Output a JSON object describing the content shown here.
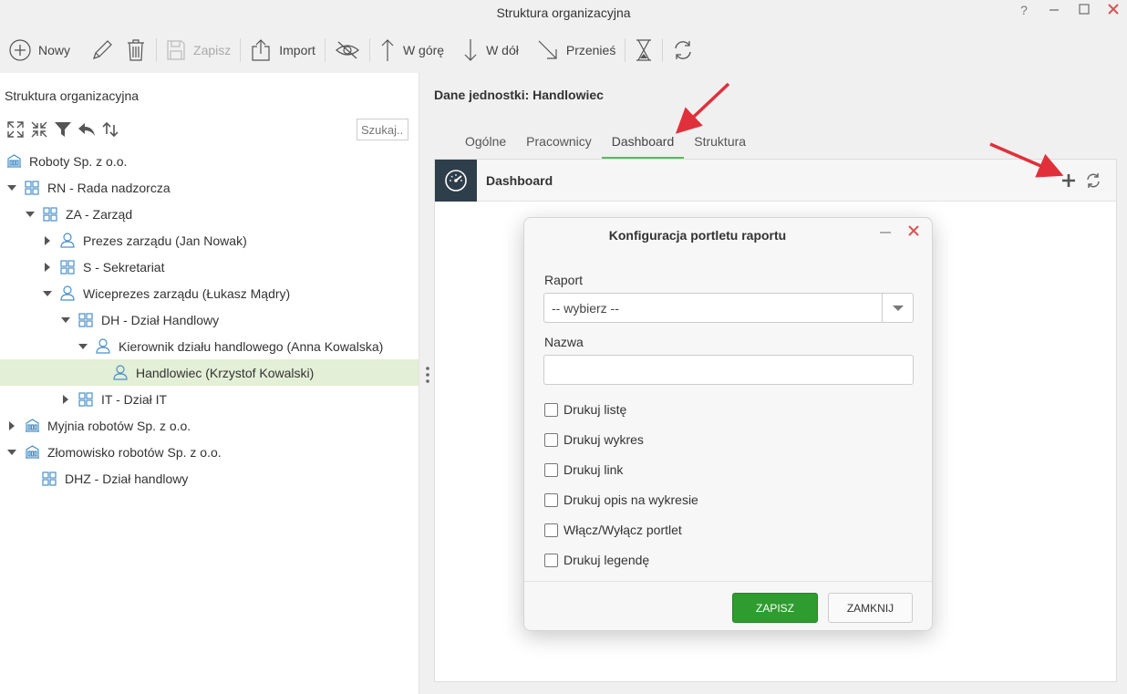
{
  "window": {
    "title": "Struktura organizacyjna",
    "help": "?",
    "minimize": "—",
    "maximize": "☐",
    "close": "✕"
  },
  "toolbar": {
    "new_label": "Nowy",
    "save_label": "Zapisz",
    "import_label": "Import",
    "up_label": "W górę",
    "down_label": "W dół",
    "move_label": "Przenieś"
  },
  "left_panel": {
    "title": "Struktura organizacyjna",
    "search_placeholder": "Szukaj..."
  },
  "tree": [
    {
      "label": "Roboty Sp. z o.o.",
      "type": "company",
      "expand": "none"
    },
    {
      "label": "RN - Rada nadzorcza",
      "type": "unit",
      "expand": "open"
    },
    {
      "label": "ZA - Zarząd",
      "type": "unit",
      "expand": "open"
    },
    {
      "label": "Prezes zarządu (Jan Nowak)",
      "type": "person",
      "expand": "closed"
    },
    {
      "label": "S - Sekretariat",
      "type": "unit",
      "expand": "closed"
    },
    {
      "label": "Wiceprezes zarządu (Łukasz Mądry)",
      "type": "person",
      "expand": "open"
    },
    {
      "label": "DH - Dział Handlowy",
      "type": "unit",
      "expand": "open"
    },
    {
      "label": "Kierownik działu handlowego (Anna Kowalska)",
      "type": "person",
      "expand": "open"
    },
    {
      "label": "Handlowiec (Krzystof Kowalski)",
      "type": "person",
      "expand": "none",
      "selected": true
    },
    {
      "label": "IT - Dział IT",
      "type": "unit",
      "expand": "closed"
    },
    {
      "label": "Myjnia robotów Sp. z o.o.",
      "type": "company",
      "expand": "closed"
    },
    {
      "label": "Złomowisko robotów Sp. z o.o.",
      "type": "company",
      "expand": "open"
    },
    {
      "label": "DHZ - Dział handlowy",
      "type": "unit",
      "expand": "none"
    }
  ],
  "right_panel": {
    "title": "Dane jednostki: Handlowiec",
    "tabs": [
      "Ogólne",
      "Pracownicy",
      "Dashboard",
      "Struktura"
    ],
    "active_tab": "Dashboard",
    "dashboard_title": "Dashboard"
  },
  "modal": {
    "title": "Konfiguracja portletu raportu",
    "report_label": "Raport",
    "report_value": "-- wybierz --",
    "name_label": "Nazwa",
    "name_value": "",
    "checkboxes": [
      "Drukuj listę",
      "Drukuj wykres",
      "Drukuj link",
      "Drukuj opis na wykresie",
      "Włącz/Wyłącz portlet",
      "Drukuj legendę"
    ],
    "save_label": "ZAPISZ",
    "close_label": "ZAMKNIJ"
  },
  "colors": {
    "accent_green": "#2e9c2e",
    "tab_underline": "#5cb85c",
    "selected_row": "#e3efd6",
    "tree_icon_blue": "#4a90c8",
    "close_red": "#d9534f",
    "annotation_arrow": "#e0303a",
    "dash_icon_bg": "#2f3e4b"
  }
}
